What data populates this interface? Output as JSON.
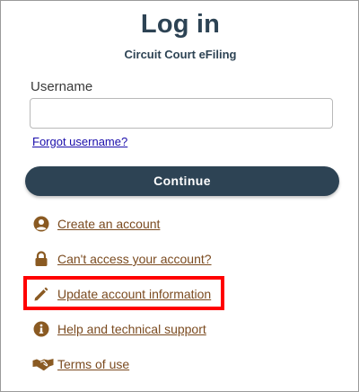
{
  "header": {
    "title": "Log in",
    "subtitle": "Circuit Court eFiling"
  },
  "form": {
    "username_label": "Username",
    "username_value": "",
    "username_placeholder": "",
    "forgot_username": "Forgot username?",
    "continue_label": "Continue"
  },
  "links": [
    {
      "label": "Create an account",
      "icon": "user-circle-icon"
    },
    {
      "label": "Can't access your account?",
      "icon": "lock-icon"
    },
    {
      "label": "Update account information",
      "icon": "pencil-icon"
    },
    {
      "label": "Help and technical support",
      "icon": "info-circle-icon"
    },
    {
      "label": "Terms of use",
      "icon": "handshake-icon"
    }
  ],
  "colors": {
    "primary": "#2d4354",
    "link": "#7b4b20",
    "icon": "#8a5a22",
    "highlight": "#ff0000",
    "forgot_link": "#1a0dab"
  }
}
